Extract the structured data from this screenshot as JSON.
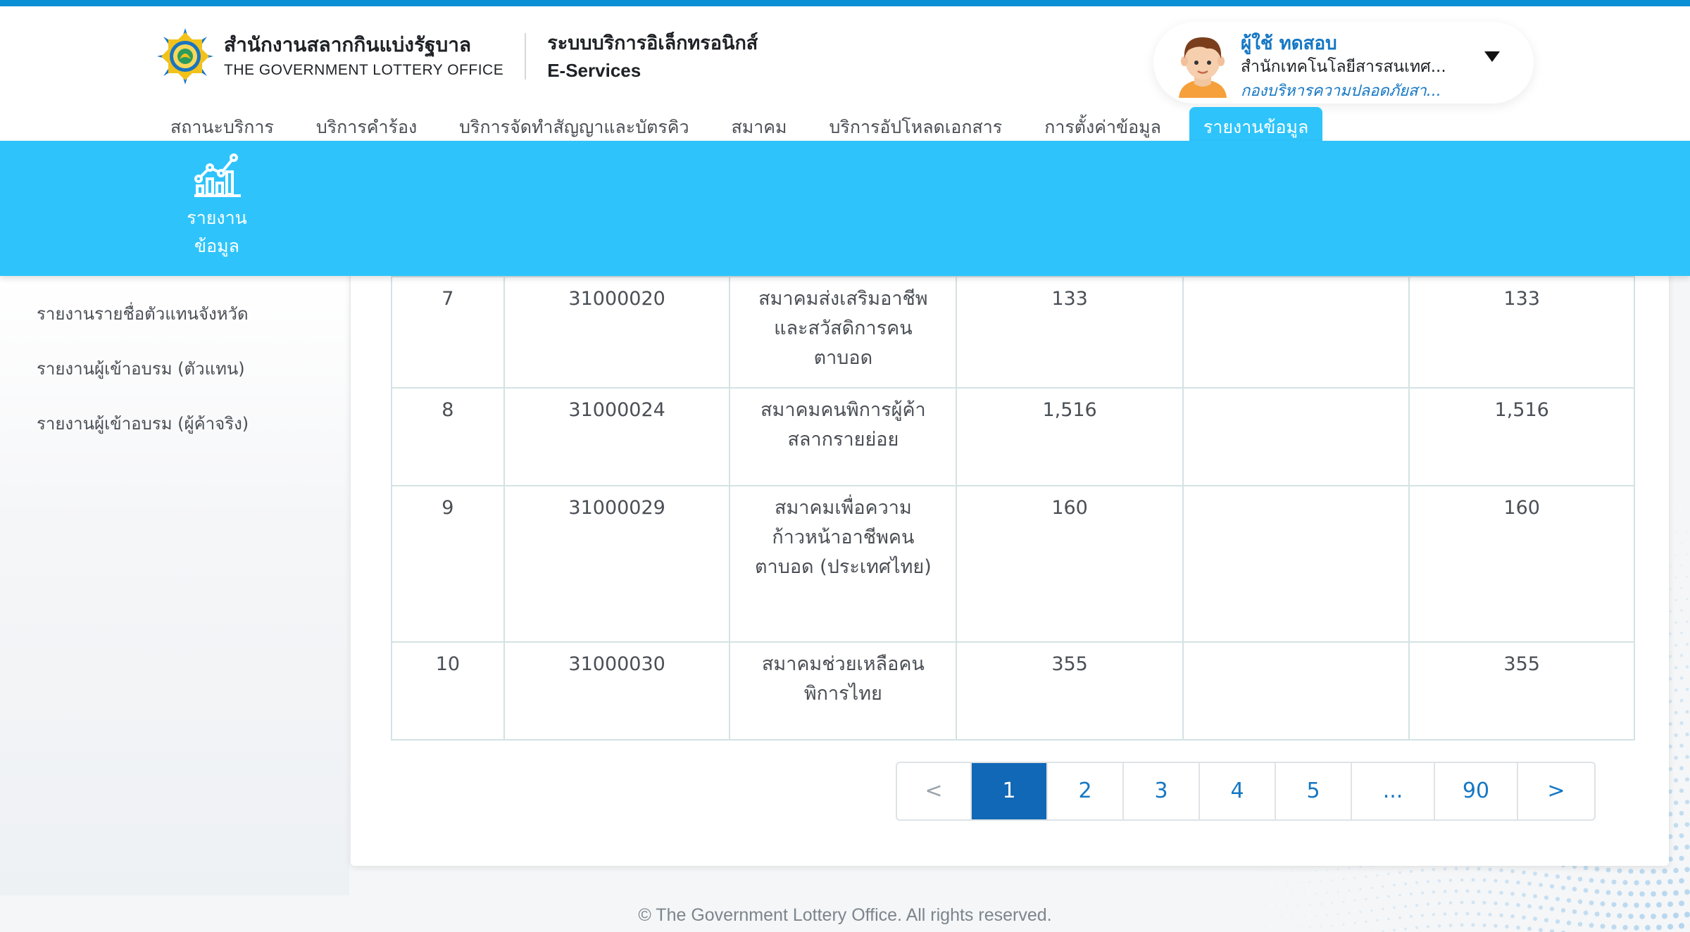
{
  "header": {
    "org_th": "สำนักงานสลากกินแบ่งรัฐบาล",
    "org_en": "THE GOVERNMENT LOTTERY OFFICE",
    "system_th": "ระบบบริการอิเล็กทรอนิกส์",
    "system_en": "E-Services"
  },
  "user": {
    "name": "ผู้ใช้ ทดสอบ",
    "department": "สำนักเทคโนโลยีสารสนเทศ...",
    "unit": "กองบริหารความปลอดภัยสา..."
  },
  "nav": {
    "items": [
      {
        "label": "สถานะบริการ"
      },
      {
        "label": "บริการคำร้อง"
      },
      {
        "label": "บริการจัดทำสัญญาและบัตรคิว"
      },
      {
        "label": "สมาคม"
      },
      {
        "label": "บริการอัปโหลดเอกสาร"
      },
      {
        "label": "การตั้งค่าข้อมูล"
      },
      {
        "label": "รายงานข้อมูล"
      }
    ],
    "active": "รายงานข้อมูล"
  },
  "band": {
    "label": "รายงานข้อมูล",
    "icon": "chart-report-icon"
  },
  "sidebar": {
    "items": [
      {
        "label": "รายงานรายชื่อตัวแทนจังหวัด"
      },
      {
        "label": "รายงานผู้เข้าอบรม (ตัวแทน)"
      },
      {
        "label": "รายงานผู้เข้าอบรม (ผู้ค้าจริง)"
      }
    ]
  },
  "table": {
    "rows": [
      {
        "no": "7",
        "code": "31000020",
        "name": "สมาคมส่งเสริมอาชีพ และสวัสดิการคน ตาบอด",
        "col4": "133",
        "col5": "",
        "col6": "133"
      },
      {
        "no": "8",
        "code": "31000024",
        "name": "สมาคมคนพิการผู้ค้า สลากรายย่อย",
        "col4": "1,516",
        "col5": "",
        "col6": "1,516"
      },
      {
        "no": "9",
        "code": "31000029",
        "name": "สมาคมเพื่อความ ก้าวหน้าอาชีพคน ตาบอด (ประเทศไทย)",
        "col4": "160",
        "col5": "",
        "col6": "160"
      },
      {
        "no": "10",
        "code": "31000030",
        "name": "สมาคมช่วยเหลือคน พิการไทย",
        "col4": "355",
        "col5": "",
        "col6": "355"
      }
    ]
  },
  "pagination": {
    "prev": "<",
    "pages": [
      "1",
      "2",
      "3",
      "4",
      "5",
      "...",
      "90"
    ],
    "current": "1",
    "next": ">"
  },
  "footer": {
    "text": "© The Government Lottery Office. All rights reserved."
  },
  "colors": {
    "primary": "#1577c4",
    "band": "#2ec4fb",
    "active_page": "#1068b7",
    "top_line": "#0a8fd4"
  }
}
